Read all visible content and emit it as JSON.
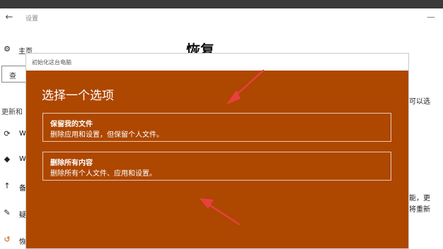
{
  "window": {
    "title": "设置",
    "back_icon": "back-arrow-icon",
    "minimize_icon": "minimize-icon"
  },
  "sidebar": {
    "home_label": "主页",
    "search_text": "查",
    "section_heading": "更新和",
    "items": [
      {
        "icon": "sync-icon",
        "glyph": "⟳",
        "label": "W"
      },
      {
        "icon": "shield-icon",
        "glyph": "◆",
        "label": "W"
      },
      {
        "icon": "upload-arrow-icon",
        "glyph": "↑",
        "label": "备"
      },
      {
        "icon": "wrench-icon",
        "glyph": "✎",
        "label": "疑"
      },
      {
        "icon": "recovery-icon",
        "glyph": "↺",
        "label": "恢"
      }
    ]
  },
  "main": {
    "title": "恢复",
    "right_fragments": [
      "可以选",
      "能，更",
      "将重新"
    ]
  },
  "dialog": {
    "title": "初始化这台电脑",
    "heading": "选择一个选项",
    "options": [
      {
        "title": "保留我的文件",
        "description": "删除应用和设置，但保留个人文件。"
      },
      {
        "title": "删除所有内容",
        "description": "删除所有个人文件、应用和设置。"
      }
    ]
  },
  "annotations": {
    "arrow_color": "#e84040"
  }
}
